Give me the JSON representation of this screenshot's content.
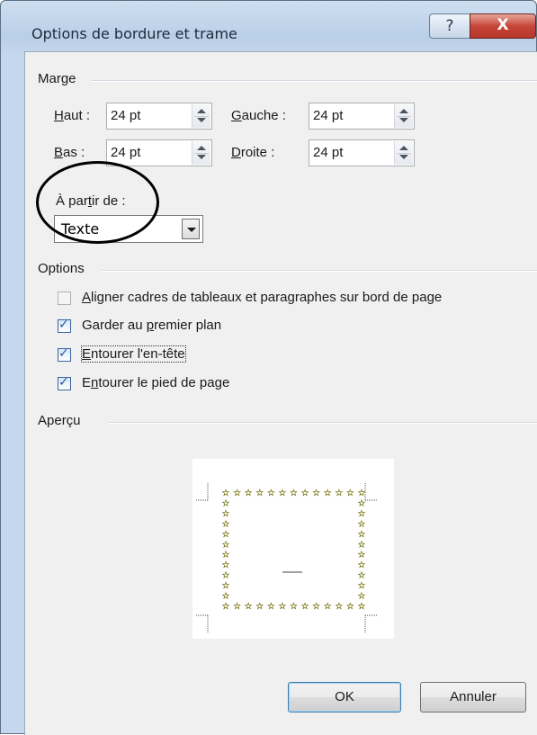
{
  "window": {
    "title": "Options de bordure et trame",
    "help_glyph": "?",
    "close_glyph": "X"
  },
  "marge": {
    "group_label": "Marge",
    "haut": {
      "access": "H",
      "rest": "aut :",
      "value": "24 pt"
    },
    "bas": {
      "access": "B",
      "rest": "as :",
      "value": "24 pt"
    },
    "gauche": {
      "access": "G",
      "rest": "auche :",
      "value": "24 pt"
    },
    "droite": {
      "access": "D",
      "rest": "roite :",
      "value": "24 pt"
    },
    "a_partir_de": {
      "pre": "À par",
      "access": "t",
      "post": "ir de :",
      "value": "Texte"
    }
  },
  "options": {
    "group_label": "Options",
    "items": [
      {
        "pre": "",
        "access": "A",
        "post": "ligner cadres de tableaux et paragraphes sur bord de page",
        "checked": false
      },
      {
        "pre": "Garder au ",
        "access": "p",
        "post": "remier plan",
        "checked": true
      },
      {
        "pre": "",
        "access": "E",
        "post": "ntourer l'en-tête",
        "checked": true
      },
      {
        "pre": "E",
        "access": "n",
        "post": "tourer le pied de page",
        "checked": true
      }
    ]
  },
  "apercu": {
    "group_label": "Aperçu",
    "border_glyph": "☆",
    "border_color": "#c9c400"
  },
  "buttons": {
    "ok": "OK",
    "cancel": "Annuler"
  },
  "colors": {
    "title_bar": "#c4d7ec",
    "close_red": "#c6463a",
    "dialog_bg": "#f0f0f0"
  }
}
